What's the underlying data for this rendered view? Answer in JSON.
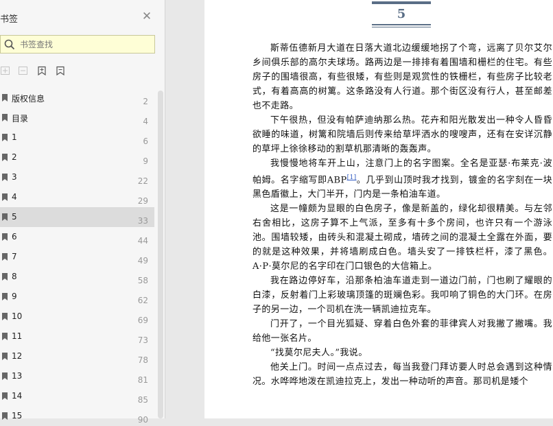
{
  "sidebar": {
    "title": "书签",
    "search_placeholder": "书签查找",
    "bookmarks": [
      {
        "label": "版权信息",
        "page": "2"
      },
      {
        "label": "目录",
        "page": "4"
      },
      {
        "label": "1",
        "page": "6"
      },
      {
        "label": "2",
        "page": "9"
      },
      {
        "label": "3",
        "page": "22"
      },
      {
        "label": "4",
        "page": "29"
      },
      {
        "label": "5",
        "page": "33"
      },
      {
        "label": "6",
        "page": "44"
      },
      {
        "label": "7",
        "page": "49"
      },
      {
        "label": "8",
        "page": "58"
      },
      {
        "label": "9",
        "page": "62"
      },
      {
        "label": "10",
        "page": "69"
      },
      {
        "label": "11",
        "page": "73"
      },
      {
        "label": "12",
        "page": "78"
      },
      {
        "label": "13",
        "page": "81"
      },
      {
        "label": "14",
        "page": "85"
      },
      {
        "label": "15",
        "page": "90"
      }
    ],
    "selected": 6
  },
  "page": {
    "chapter": "5",
    "paragraphs": [
      "斯蒂伍德新月大道在日落大道北边缓缓地拐了个弯，远离了贝尔艾尔乡间俱乐部的高尔夫球场。路两边是一排排有着围墙和栅栏的住宅。有些房子的围墙很高，有些很矮，有些则是观赏性的铁栅栏，有些房子比较老式，有着高高的树篱。这条路没有人行道。那个街区没有行人，甚至邮差也不走路。",
      "下午很热，但没有帕萨迪纳那么热。花卉和阳光散发出一种令人昏昏欲睡的味道，树篱和院墙后则传来给草坪洒水的嗖嗖声，还有在安详沉静的草坪上徐徐移动的割草机那清晰的轰轰声。",
      "我慢慢地将车开上山，注意门上的名字图案。全名是亚瑟·布莱克·波帕姆。名字缩写即ABP[1]。几乎到山顶时我才找到，镀金的名字刻在一块黑色盾徽上，大门半开，门内是一条柏油车道。",
      "这是一幢颇为显眼的白色房子，像是新盖的，绿化却很精美。与左邻右舍相比，这房子算不上气派，至多有十多个房间，也许只有一个游泳池。围墙较矮，由砖头和混凝土砌成，墙砖之间的混凝土全露在外面，要的就是这种效果，并将墙刷成白色。墙头安了一排铁栏杆，漆了黑色。A·P·莫尔尼的名字印在门口银色的大信箱上。",
      "我在路边停好车，沿那条柏油车道走到一道边门前，门也刷了耀眼的白漆，反射着门上彩玻璃顶篷的斑斓色彩。我叩响了铜色的大门环。在房子的另一边，一个司机在洗一辆凯迪拉克车。",
      "门开了，一个目光狐疑、穿着白色外套的菲律宾人对我撇了撇嘴。我给他一张名片。",
      "“找莫尔尼夫人。”我说。",
      "他关上门。时间一点点过去，每当我登门拜访要人时总会遇到这种情况。水哗哗地泼在凯迪拉克上，发出一种动听的声音。那司机是矮个"
    ]
  }
}
